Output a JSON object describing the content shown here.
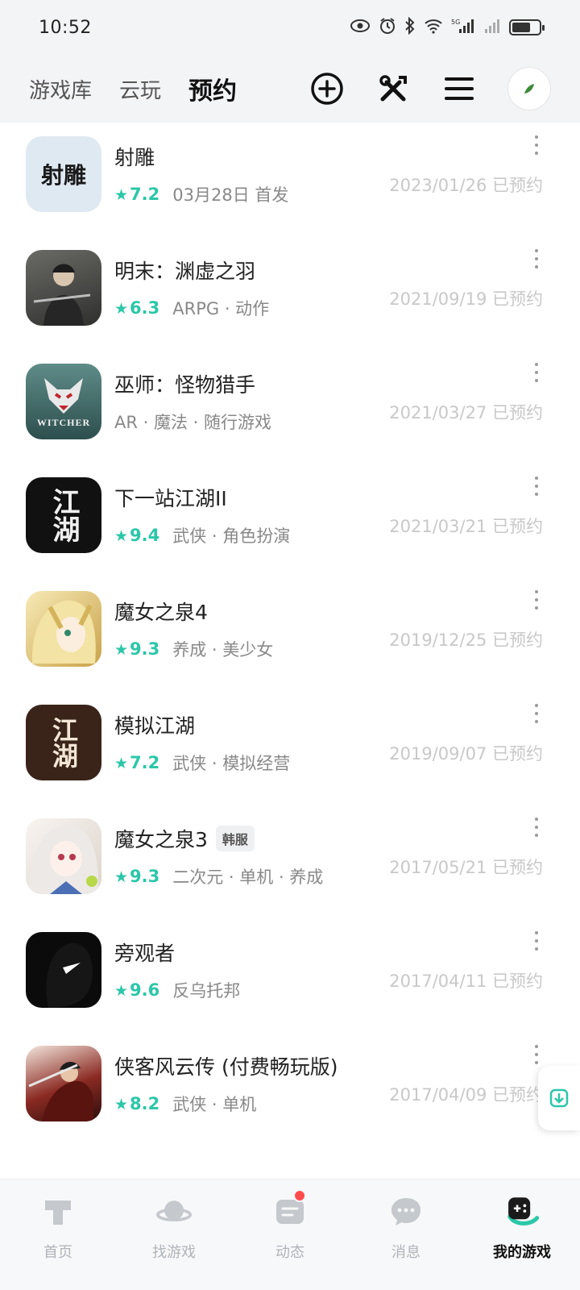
{
  "status_bar": {
    "time": "10:52",
    "net_label": "5G"
  },
  "header": {
    "tabs": [
      {
        "label": "游戏库",
        "active": false
      },
      {
        "label": "云玩",
        "active": false
      },
      {
        "label": "预约",
        "active": true
      }
    ],
    "actions": [
      "add-circle-icon",
      "tools-icon",
      "menu-icon",
      "avatar"
    ]
  },
  "games": [
    {
      "title": "射雕",
      "rating": "7.2",
      "tags": "03月28日 首发",
      "date": "2023/01/26 已预约",
      "badge": "",
      "cover_text": "射雕",
      "cover_bg": "#dfe9f1",
      "cover_fg": "#1a1a1a"
    },
    {
      "title": "明末：渊虚之羽",
      "rating": "6.3",
      "tags": "ARPG · 动作",
      "date": "2021/09/19 已预约",
      "badge": "",
      "cover_text": "",
      "cover_bg": "#4a4a48",
      "cover_fg": "#ddd"
    },
    {
      "title": "巫师：怪物猎手",
      "rating": "",
      "tags": "AR · 魔法 · 随行游戏",
      "date": "2021/03/27 已预约",
      "badge": "",
      "cover_text": "WITCHER",
      "cover_bg": "#3f6c6a",
      "cover_fg": "#f1f1f1"
    },
    {
      "title": "下一站江湖II",
      "rating": "9.4",
      "tags": "武侠 · 角色扮演",
      "date": "2021/03/21 已预约",
      "badge": "",
      "cover_text": "江湖",
      "cover_bg": "#111111",
      "cover_fg": "#f0f0f0"
    },
    {
      "title": "魔女之泉4",
      "rating": "9.3",
      "tags": "养成 · 美少女",
      "date": "2019/12/25 已预约",
      "badge": "",
      "cover_text": "",
      "cover_bg": "#e9d38a",
      "cover_fg": "#5a4a20"
    },
    {
      "title": "模拟江湖",
      "rating": "7.2",
      "tags": "武侠 · 模拟经营",
      "date": "2019/09/07 已预约",
      "badge": "",
      "cover_text": "江湖",
      "cover_bg": "#3a2419",
      "cover_fg": "#f3e6d6"
    },
    {
      "title": "魔女之泉3",
      "rating": "9.3",
      "tags": "二次元 · 单机 · 养成",
      "date": "2017/05/21 已预约",
      "badge": "韩服",
      "cover_text": "",
      "cover_bg": "#efe9e4",
      "cover_fg": "#b45060"
    },
    {
      "title": "旁观者",
      "rating": "9.6",
      "tags": "反乌托邦",
      "date": "2017/04/11 已预约",
      "badge": "",
      "cover_text": "",
      "cover_bg": "#0b0b0b",
      "cover_fg": "#ffffff"
    },
    {
      "title": "侠客风云传 (付费畅玩版)",
      "rating": "8.2",
      "tags": "武侠 · 单机",
      "date": "2017/04/09 已预约",
      "badge": "",
      "cover_text": "",
      "cover_bg": "#8a2a22",
      "cover_fg": "#f6e6dd"
    }
  ],
  "bottom_nav": [
    {
      "label": "首页",
      "icon": "home-icon",
      "active": false
    },
    {
      "label": "找游戏",
      "icon": "planet-icon",
      "active": false
    },
    {
      "label": "动态",
      "icon": "activity-icon",
      "active": false,
      "dot": true
    },
    {
      "label": "消息",
      "icon": "chat-icon",
      "active": false
    },
    {
      "label": "我的游戏",
      "icon": "gamepad-icon",
      "active": true
    }
  ],
  "colors": {
    "accent": "#2bc7a8",
    "muted": "#888888",
    "date": "#c8c8c8"
  }
}
